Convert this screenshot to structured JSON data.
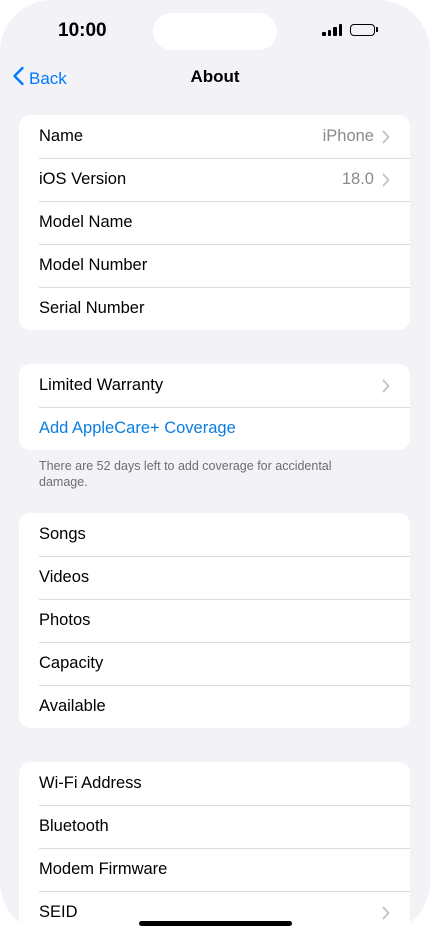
{
  "status_bar": {
    "time": "10:00"
  },
  "nav": {
    "back_label": "Back",
    "title": "About"
  },
  "groups": [
    {
      "rows": [
        {
          "label": "Name",
          "value": "iPhone",
          "chevron": true
        },
        {
          "label": "iOS Version",
          "value": "18.0",
          "chevron": true
        },
        {
          "label": "Model Name",
          "value": "",
          "chevron": false
        },
        {
          "label": "Model Number",
          "value": "",
          "chevron": false
        },
        {
          "label": "Serial Number",
          "value": "",
          "chevron": false
        }
      ]
    },
    {
      "rows": [
        {
          "label": "Limited Warranty",
          "value": "",
          "chevron": true
        },
        {
          "label": "Add AppleCare+ Coverage",
          "value": "",
          "chevron": false
        }
      ],
      "footnote": "There are 52 days left to add coverage for accidental damage."
    },
    {
      "rows": [
        {
          "label": "Songs",
          "value": "",
          "chevron": false
        },
        {
          "label": "Videos",
          "value": "",
          "chevron": false
        },
        {
          "label": "Photos",
          "value": "",
          "chevron": false
        },
        {
          "label": "Capacity",
          "value": "",
          "chevron": false
        },
        {
          "label": "Available",
          "value": "",
          "chevron": false
        }
      ]
    },
    {
      "rows": [
        {
          "label": "Wi-Fi Address",
          "value": "",
          "chevron": false
        },
        {
          "label": "Bluetooth",
          "value": "",
          "chevron": false
        },
        {
          "label": "Modem Firmware",
          "value": "",
          "chevron": false
        },
        {
          "label": "SEID",
          "value": "",
          "chevron": true
        }
      ]
    }
  ],
  "colors": {
    "accent": "#007aff",
    "link": "#0a7ee0",
    "background": "#f2f2f7",
    "secondary_text": "#8a8a8e"
  },
  "icons": {
    "back": "chevron-left-icon",
    "row_disclosure": "chevron-right-icon"
  }
}
